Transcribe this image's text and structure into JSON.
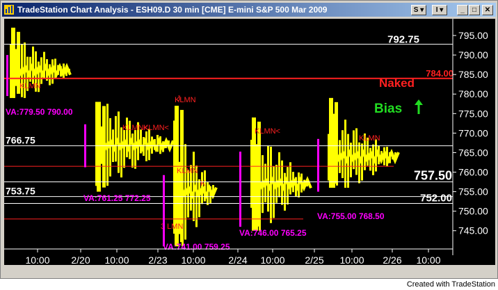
{
  "window": {
    "title": "TradeStation Chart Analysis - ESH09.D  30 min  [CME] E-mini S&P 500 Mar 2009",
    "sym_button": "S",
    "ind_button": "I"
  },
  "chart_data": {
    "type": "market-profile",
    "symbol": "ESH09.D",
    "interval": "30 min",
    "y_ticks": [
      "795.00",
      "790.00",
      "785.00",
      "780.00",
      "775.00",
      "770.00",
      "765.00",
      "760.00",
      "755.00",
      "750.00",
      "745.00"
    ],
    "x_labels": [
      "10:00",
      "2/20",
      "10:00",
      "2/23",
      "10:00",
      "2/24",
      "10:00",
      "2/25",
      "10:00",
      "2/26",
      "10:00"
    ],
    "levels": [
      {
        "label": "792.75",
        "value": 792.75,
        "color": "#ffffff"
      },
      {
        "label": "784.00",
        "value": 784.0,
        "color": "#ff2020"
      },
      {
        "label": "766.75",
        "value": 766.75,
        "color": "#ffffff"
      },
      {
        "label": "757.50",
        "value": 757.5,
        "color": "#ffffff"
      },
      {
        "label": "753.75",
        "value": 753.75,
        "color": "#ffffff"
      },
      {
        "label": "752.00",
        "value": 752.0,
        "color": "#ffffff"
      }
    ],
    "annotations": {
      "naked": "Naked",
      "bias": "Bias",
      "bias_arrow": "up-arrow-icon"
    },
    "value_areas": [
      {
        "label": "VA:779.50 790.00",
        "low": 779.5,
        "high": 790.0
      },
      {
        "label": "VA:761.25 772.25",
        "low": 761.25,
        "high": 772.25
      },
      {
        "label": "VA:741.00 759.25",
        "low": 741.0,
        "high": 759.25
      },
      {
        "label": "VA:746.00 765.25",
        "low": 746.0,
        "high": 765.25
      },
      {
        "label": "VA:755.00 768.50",
        "low": 755.0,
        "high": 768.5
      }
    ],
    "profile_letters": [
      "KLMN",
      "KLMN<",
      "KLMN<",
      "KLMN",
      "KLMN<",
      "KLMN",
      "KLMN",
      "3 LMN",
      "J",
      "K"
    ],
    "colors": {
      "profile": "#ffff00",
      "value_area": "#ff00ff",
      "naked": "#ff2020",
      "bias": "#22dd22"
    }
  },
  "footer": {
    "credit": "Created with TradeStation"
  }
}
